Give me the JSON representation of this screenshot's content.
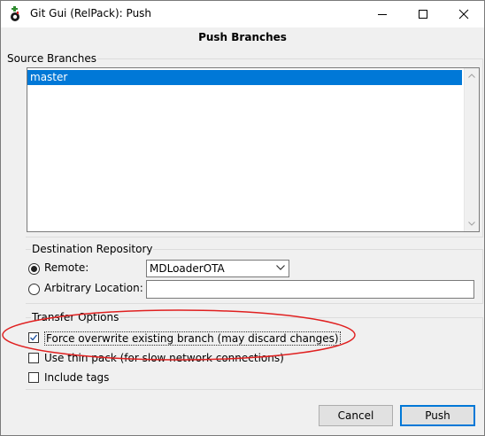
{
  "window": {
    "title": "Git Gui (RelPack): Push"
  },
  "dialog": {
    "heading": "Push Branches"
  },
  "source_branches": {
    "label": "Source Branches",
    "items": [
      "master"
    ],
    "selected": "master"
  },
  "destination": {
    "label": "Destination Repository",
    "remote_label": "Remote:",
    "remote_selected": true,
    "remote_value": "MDLoaderOTA",
    "arbitrary_label": "Arbitrary Location:",
    "arbitrary_value": ""
  },
  "transfer": {
    "label": "Transfer Options",
    "force_label": "Force overwrite existing branch (may discard changes)",
    "force_checked": true,
    "thin_label": "Use thin pack (for slow network connections)",
    "thin_checked": false,
    "tags_label": "Include tags",
    "tags_checked": false
  },
  "buttons": {
    "cancel": "Cancel",
    "push": "Push"
  },
  "colors": {
    "selection": "#0078d7",
    "annotation": "#e02020"
  }
}
